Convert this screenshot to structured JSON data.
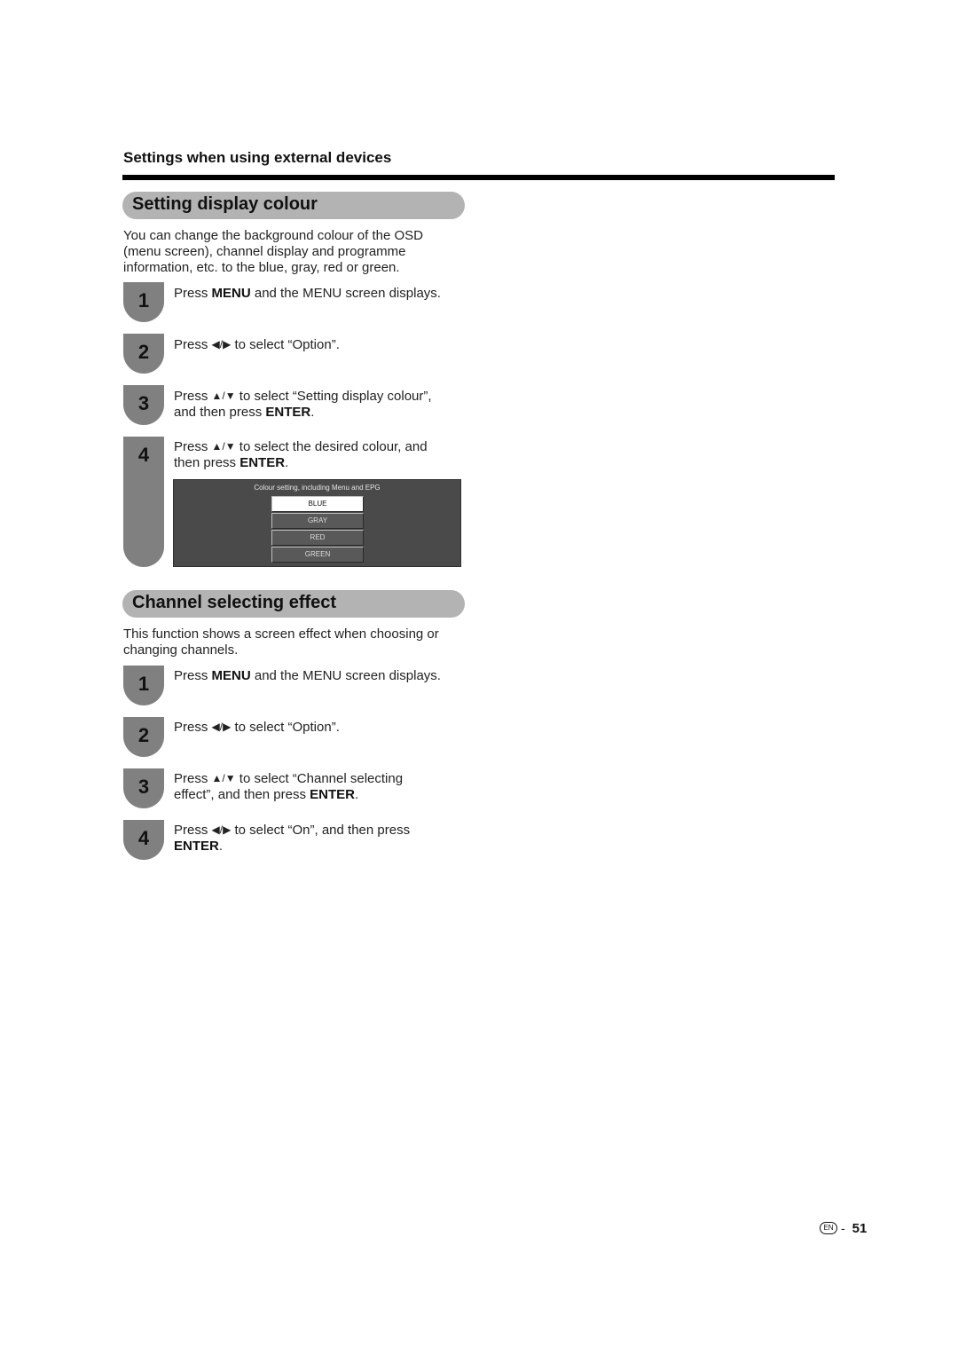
{
  "header": {
    "chapter_title": "Settings when using external devices"
  },
  "sections": [
    {
      "title": "Setting display colour",
      "intro_lines": [
        "You can change the background colour of the OSD",
        "(menu screen), channel display and programme",
        "information, etc. to the blue, gray, red or green."
      ],
      "steps": [
        {
          "number": "1",
          "pre": "Press ",
          "bold": "MENU",
          "post": " and the MENU screen displays."
        },
        {
          "number": "2",
          "pre": "Press ",
          "arrows": "◀/▶",
          "post": " to select “Option”."
        },
        {
          "number": "3",
          "pre": "Press ",
          "arrows": "▲/▼",
          "post": " to select “Setting display colour”,",
          "line2_pre": "and then press ",
          "line2_bold": "ENTER",
          "line2_post": "."
        },
        {
          "number": "4",
          "pre": "Press ",
          "arrows": "▲/▼",
          "post": " to select the desired colour, and",
          "line2_pre": "then press ",
          "line2_bold": "ENTER",
          "line2_post": "."
        }
      ],
      "osd": {
        "title": "Colour setting, including Menu and EPG",
        "options": [
          "BLUE",
          "GRAY",
          "RED",
          "GREEN"
        ],
        "selected": "BLUE"
      }
    },
    {
      "title": "Channel selecting effect",
      "intro_lines": [
        "This function shows a screen effect when choosing or",
        "changing channels."
      ],
      "steps": [
        {
          "number": "1",
          "pre": "Press ",
          "bold": "MENU",
          "post": " and the MENU screen displays."
        },
        {
          "number": "2",
          "pre": "Press ",
          "arrows": "◀/▶",
          "post": " to select “Option”."
        },
        {
          "number": "3",
          "pre": "Press ",
          "arrows": "▲/▼",
          "post": " to select “Channel selecting",
          "line2_pre": "effect”, and then press ",
          "line2_bold": "ENTER",
          "line2_post": "."
        },
        {
          "number": "4",
          "pre": "Press ",
          "arrows": "◀/▶",
          "post": " to select “On”, and then press",
          "line2_pre": "",
          "line2_bold": "ENTER",
          "line2_post": "."
        }
      ]
    }
  ],
  "footer": {
    "language_badge": "EN",
    "separator": "-",
    "page_number": "51"
  }
}
